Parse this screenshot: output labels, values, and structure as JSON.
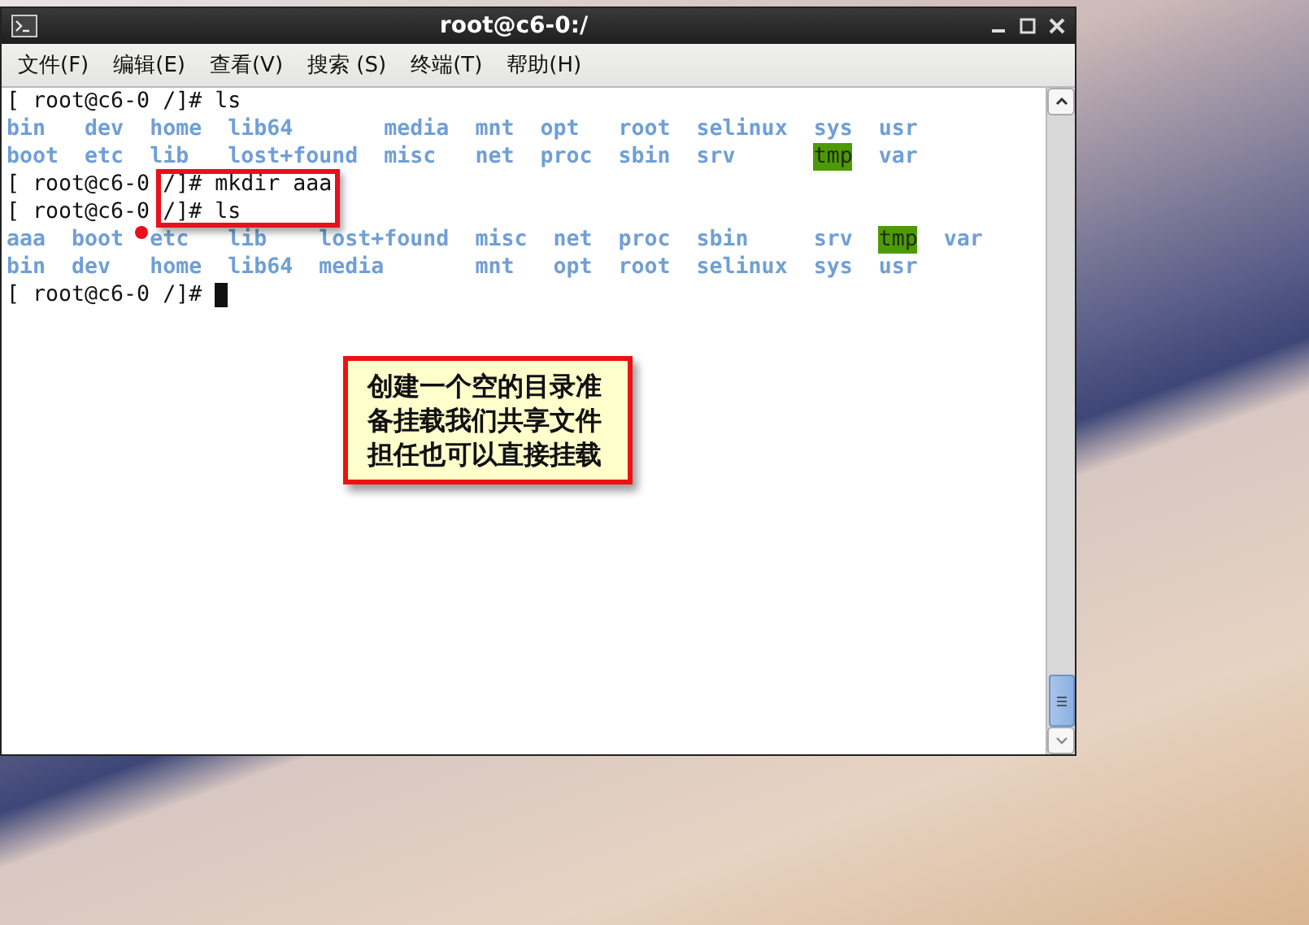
{
  "window": {
    "title": "root@c6-0:/"
  },
  "menu": [
    {
      "label": "文件(F)"
    },
    {
      "label": "编辑(E)"
    },
    {
      "label": "查看(V)"
    },
    {
      "label": "搜索 (S)"
    },
    {
      "label": "终端(T)"
    },
    {
      "label": "帮助(H)"
    }
  ],
  "terminal": {
    "lines": [
      {
        "kind": "command",
        "text": "[ root@c6-0 /]# ls"
      },
      {
        "kind": "listing",
        "entries": [
          {
            "name": "bin",
            "kind": "dir"
          },
          {
            "name": "boot",
            "kind": "dir"
          },
          {
            "name": "dev",
            "kind": "dir"
          },
          {
            "name": "etc",
            "kind": "dir"
          },
          {
            "name": "home",
            "kind": "dir"
          },
          {
            "name": "lib",
            "kind": "dir"
          },
          {
            "name": "lib64",
            "kind": "dir"
          },
          {
            "name": "lost+found",
            "kind": "dir"
          },
          {
            "name": "media",
            "kind": "dir"
          },
          {
            "name": "misc",
            "kind": "dir"
          },
          {
            "name": "mnt",
            "kind": "dir"
          },
          {
            "name": "net",
            "kind": "dir"
          },
          {
            "name": "opt",
            "kind": "dir"
          },
          {
            "name": "proc",
            "kind": "dir"
          },
          {
            "name": "root",
            "kind": "dir"
          },
          {
            "name": "sbin",
            "kind": "dir"
          },
          {
            "name": "selinux",
            "kind": "dir"
          },
          {
            "name": "srv",
            "kind": "dir"
          },
          {
            "name": "sys",
            "kind": "dir"
          },
          {
            "name": "tmp",
            "kind": "sticky"
          },
          {
            "name": "usr",
            "kind": "dir"
          },
          {
            "name": "var",
            "kind": "dir"
          }
        ]
      },
      {
        "kind": "command",
        "text": "[ root@c6-0 /]# mkdir aaa"
      },
      {
        "kind": "command",
        "text": "[ root@c6-0 /]# ls"
      },
      {
        "kind": "listing",
        "entries": [
          {
            "name": "aaa",
            "kind": "dir"
          },
          {
            "name": "bin",
            "kind": "dir"
          },
          {
            "name": "boot",
            "kind": "dir"
          },
          {
            "name": "dev",
            "kind": "dir"
          },
          {
            "name": "etc",
            "kind": "dir"
          },
          {
            "name": "home",
            "kind": "dir"
          },
          {
            "name": "lib",
            "kind": "dir"
          },
          {
            "name": "lib64",
            "kind": "dir"
          },
          {
            "name": "lost+found",
            "kind": "dir"
          },
          {
            "name": "media",
            "kind": "dir"
          },
          {
            "name": "misc",
            "kind": "dir"
          },
          {
            "name": "mnt",
            "kind": "dir"
          },
          {
            "name": "net",
            "kind": "dir"
          },
          {
            "name": "opt",
            "kind": "dir"
          },
          {
            "name": "proc",
            "kind": "dir"
          },
          {
            "name": "root",
            "kind": "dir"
          },
          {
            "name": "sbin",
            "kind": "dir"
          },
          {
            "name": "selinux",
            "kind": "dir"
          },
          {
            "name": "srv",
            "kind": "dir"
          },
          {
            "name": "sys",
            "kind": "dir"
          },
          {
            "name": "tmp",
            "kind": "sticky"
          },
          {
            "name": "usr",
            "kind": "dir"
          },
          {
            "name": "var",
            "kind": "dir"
          }
        ]
      },
      {
        "kind": "command",
        "text": "[ root@c6-0 /]#",
        "cursor": true
      }
    ]
  },
  "annotation": {
    "text": "创建一个空的目录准备挂载我们共享文件担任也可以直接挂载"
  }
}
